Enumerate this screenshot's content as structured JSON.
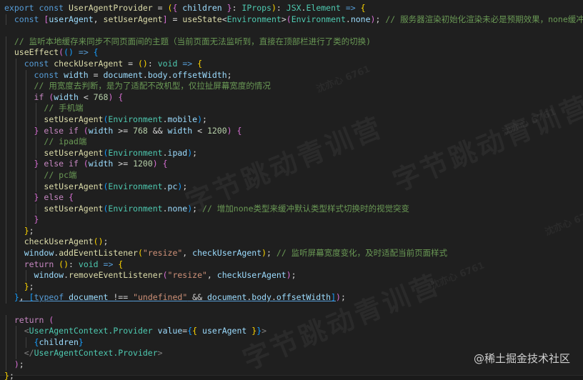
{
  "editor": {
    "theme": {
      "background": "#1f1f1f",
      "keyword": "#569cd6",
      "control": "#c586c0",
      "function": "#dcdcaa",
      "variable": "#9cdcfe",
      "type": "#4ec9b0",
      "string": "#ce9178",
      "number": "#b5cea8",
      "comment": "#6a9955"
    },
    "lines": [
      {
        "indent": 0,
        "tokens": [
          [
            "keyword",
            "export const "
          ],
          [
            "function",
            "UserAgentProvider"
          ],
          [
            "plain",
            " = "
          ],
          [
            "bracket1",
            "("
          ],
          [
            "bracket2",
            "{"
          ],
          [
            "variable",
            " children "
          ],
          [
            "bracket2",
            "}"
          ],
          [
            "plain",
            ": "
          ],
          [
            "type",
            "IProps"
          ],
          [
            "bracket1",
            ")"
          ],
          [
            "plain",
            ": "
          ],
          [
            "type",
            "JSX"
          ],
          [
            "plain",
            "."
          ],
          [
            "type",
            "Element"
          ],
          [
            "keyword",
            " => "
          ],
          [
            "bracket1",
            "{"
          ]
        ]
      },
      {
        "indent": 1,
        "tokens": [
          [
            "keyword",
            "const "
          ],
          [
            "bracket2",
            "["
          ],
          [
            "variable",
            "userAgent"
          ],
          [
            "plain",
            ", "
          ],
          [
            "function",
            "setUserAgent"
          ],
          [
            "bracket2",
            "]"
          ],
          [
            "plain",
            " = "
          ],
          [
            "function",
            "useState"
          ],
          [
            "plain",
            "<"
          ],
          [
            "type",
            "Environment"
          ],
          [
            "plain",
            ">"
          ],
          [
            "bracket2",
            "("
          ],
          [
            "type",
            "Environment"
          ],
          [
            "plain",
            "."
          ],
          [
            "variable",
            "none"
          ],
          [
            "bracket2",
            ")"
          ],
          [
            "plain",
            "; "
          ],
          [
            "comment",
            "// 服务器渲染初始化渲染未必是预期效果，none缓冲切换视觉"
          ]
        ]
      },
      {
        "indent": 0,
        "tokens": []
      },
      {
        "indent": 1,
        "tokens": [
          [
            "comment",
            "// 监听本地缓存来同步不同页面间的主题（当前页面无法监听到，直接在顶部栏进行了类的切换)"
          ]
        ]
      },
      {
        "indent": 1,
        "tokens": [
          [
            "function",
            "useEffect"
          ],
          [
            "bracket2",
            "("
          ],
          [
            "bracket3",
            "()"
          ],
          [
            "keyword",
            " => "
          ],
          [
            "bracket3",
            "{"
          ]
        ]
      },
      {
        "indent": 2,
        "tokens": [
          [
            "keyword",
            "const "
          ],
          [
            "function",
            "checkUserAgent"
          ],
          [
            "plain",
            " = "
          ],
          [
            "bracket1",
            "()"
          ],
          [
            "plain",
            ": "
          ],
          [
            "type",
            "void"
          ],
          [
            "keyword",
            " => "
          ],
          [
            "bracket1",
            "{"
          ]
        ]
      },
      {
        "indent": 3,
        "tokens": [
          [
            "keyword",
            "const "
          ],
          [
            "variable",
            "width"
          ],
          [
            "plain",
            " = "
          ],
          [
            "variable",
            "document"
          ],
          [
            "plain",
            "."
          ],
          [
            "variable",
            "body"
          ],
          [
            "plain",
            "."
          ],
          [
            "variable",
            "offsetWidth"
          ],
          [
            "plain",
            ";"
          ]
        ]
      },
      {
        "indent": 3,
        "tokens": [
          [
            "comment",
            "// 用宽度去判断，是为了适配不改机型，仅拉扯屏幕宽度的情况"
          ]
        ]
      },
      {
        "indent": 3,
        "tokens": [
          [
            "control",
            "if "
          ],
          [
            "bracket2",
            "("
          ],
          [
            "variable",
            "width"
          ],
          [
            "plain",
            " < "
          ],
          [
            "number",
            "768"
          ],
          [
            "bracket2",
            ")"
          ],
          [
            "plain",
            " "
          ],
          [
            "bracket2",
            "{"
          ]
        ]
      },
      {
        "indent": 4,
        "tokens": [
          [
            "comment",
            "// 手机端"
          ]
        ]
      },
      {
        "indent": 4,
        "tokens": [
          [
            "function",
            "setUserAgent"
          ],
          [
            "bracket3",
            "("
          ],
          [
            "type",
            "Environment"
          ],
          [
            "plain",
            "."
          ],
          [
            "variable",
            "mobile"
          ],
          [
            "bracket3",
            ")"
          ],
          [
            "plain",
            ";"
          ]
        ]
      },
      {
        "indent": 3,
        "tokens": [
          [
            "bracket2",
            "}"
          ],
          [
            "control",
            " else if "
          ],
          [
            "bracket2",
            "("
          ],
          [
            "variable",
            "width"
          ],
          [
            "plain",
            " >= "
          ],
          [
            "number",
            "768"
          ],
          [
            "plain",
            " && "
          ],
          [
            "variable",
            "width"
          ],
          [
            "plain",
            " < "
          ],
          [
            "number",
            "1200"
          ],
          [
            "bracket2",
            ")"
          ],
          [
            "plain",
            " "
          ],
          [
            "bracket2",
            "{"
          ]
        ]
      },
      {
        "indent": 4,
        "tokens": [
          [
            "comment",
            "// ipad端"
          ]
        ]
      },
      {
        "indent": 4,
        "tokens": [
          [
            "function",
            "setUserAgent"
          ],
          [
            "bracket3",
            "("
          ],
          [
            "type",
            "Environment"
          ],
          [
            "plain",
            "."
          ],
          [
            "variable",
            "ipad"
          ],
          [
            "bracket3",
            ")"
          ],
          [
            "plain",
            ";"
          ]
        ]
      },
      {
        "indent": 3,
        "tokens": [
          [
            "bracket2",
            "}"
          ],
          [
            "control",
            " else if "
          ],
          [
            "bracket2",
            "("
          ],
          [
            "variable",
            "width"
          ],
          [
            "plain",
            " >= "
          ],
          [
            "number",
            "1200"
          ],
          [
            "bracket2",
            ")"
          ],
          [
            "plain",
            " "
          ],
          [
            "bracket2",
            "{"
          ]
        ]
      },
      {
        "indent": 4,
        "tokens": [
          [
            "comment",
            "// pc端"
          ]
        ]
      },
      {
        "indent": 4,
        "tokens": [
          [
            "function",
            "setUserAgent"
          ],
          [
            "bracket3",
            "("
          ],
          [
            "type",
            "Environment"
          ],
          [
            "plain",
            "."
          ],
          [
            "variable",
            "pc"
          ],
          [
            "bracket3",
            ")"
          ],
          [
            "plain",
            ";"
          ]
        ]
      },
      {
        "indent": 3,
        "tokens": [
          [
            "bracket2",
            "}"
          ],
          [
            "control",
            " else "
          ],
          [
            "bracket2",
            "{"
          ]
        ]
      },
      {
        "indent": 4,
        "tokens": [
          [
            "function",
            "setUserAgent"
          ],
          [
            "bracket3",
            "("
          ],
          [
            "type",
            "Environment"
          ],
          [
            "plain",
            "."
          ],
          [
            "variable",
            "none"
          ],
          [
            "bracket3",
            ")"
          ],
          [
            "plain",
            "; "
          ],
          [
            "comment",
            "// 增加none类型来缓冲默认类型样式切换时的视觉突变"
          ]
        ]
      },
      {
        "indent": 3,
        "tokens": [
          [
            "bracket2",
            "}"
          ]
        ]
      },
      {
        "indent": 2,
        "tokens": [
          [
            "bracket1",
            "}"
          ],
          [
            "plain",
            ";"
          ]
        ]
      },
      {
        "indent": 2,
        "tokens": [
          [
            "function",
            "checkUserAgent"
          ],
          [
            "bracket1",
            "()"
          ],
          [
            "plain",
            ";"
          ]
        ]
      },
      {
        "indent": 2,
        "tokens": [
          [
            "variable",
            "window"
          ],
          [
            "plain",
            "."
          ],
          [
            "function",
            "addEventListener"
          ],
          [
            "bracket1",
            "("
          ],
          [
            "string",
            "\"resize\""
          ],
          [
            "plain",
            ", "
          ],
          [
            "variable",
            "checkUserAgent"
          ],
          [
            "bracket1",
            ")"
          ],
          [
            "plain",
            "; "
          ],
          [
            "comment",
            "// 监听屏幕宽度变化，及时适配当前页面样式"
          ]
        ]
      },
      {
        "indent": 2,
        "tokens": [
          [
            "control",
            "return "
          ],
          [
            "bracket1",
            "()"
          ],
          [
            "plain",
            ": "
          ],
          [
            "type",
            "void"
          ],
          [
            "keyword",
            " => "
          ],
          [
            "bracket1",
            "{"
          ]
        ]
      },
      {
        "indent": 3,
        "tokens": [
          [
            "variable",
            "window"
          ],
          [
            "plain",
            "."
          ],
          [
            "function",
            "removeEventListener"
          ],
          [
            "bracket2",
            "("
          ],
          [
            "string",
            "\"resize\""
          ],
          [
            "plain",
            ", "
          ],
          [
            "variable",
            "checkUserAgent"
          ],
          [
            "bracket2",
            ")"
          ],
          [
            "plain",
            ";"
          ]
        ]
      },
      {
        "indent": 2,
        "tokens": [
          [
            "bracket1",
            "}"
          ],
          [
            "plain",
            ";"
          ]
        ]
      },
      {
        "indent": 1,
        "tokens": [
          [
            "bracket3",
            "}"
          ],
          [
            "plain",
            ", "
          ],
          [
            "bracket3",
            "["
          ],
          [
            "keyword",
            "typeof "
          ],
          [
            "variable",
            "document"
          ],
          [
            "plain",
            " !== "
          ],
          [
            "string",
            "\"undefined\""
          ],
          [
            "plain",
            " && "
          ],
          [
            "variable",
            "document"
          ],
          [
            "plain",
            "."
          ],
          [
            "variable",
            "body"
          ],
          [
            "plain",
            "."
          ],
          [
            "variable",
            "offsetWidth"
          ],
          [
            "bracket3",
            "]"
          ],
          [
            "bracket2",
            ")"
          ],
          [
            "plain",
            ";"
          ]
        ]
      },
      {
        "indent": 0,
        "tokens": []
      },
      {
        "indent": 1,
        "tokens": [
          [
            "control",
            "return "
          ],
          [
            "bracket2",
            "("
          ]
        ]
      },
      {
        "indent": 2,
        "tokens": [
          [
            "punct-tag",
            "<"
          ],
          [
            "tag",
            "UserAgentContext.Provider"
          ],
          [
            "variable",
            " value"
          ],
          [
            "plain",
            "="
          ],
          [
            "bracket3",
            "{"
          ],
          [
            "bracket1",
            "{"
          ],
          [
            "variable",
            " userAgent "
          ],
          [
            "bracket1",
            "}"
          ],
          [
            "bracket3",
            "}"
          ],
          [
            "punct-tag",
            ">"
          ]
        ]
      },
      {
        "indent": 3,
        "tokens": [
          [
            "bracket3",
            "{"
          ],
          [
            "variable",
            "children"
          ],
          [
            "bracket3",
            "}"
          ]
        ]
      },
      {
        "indent": 2,
        "tokens": [
          [
            "punct-tag",
            "</"
          ],
          [
            "tag",
            "UserAgentContext.Provider"
          ],
          [
            "punct-tag",
            ">"
          ]
        ]
      },
      {
        "indent": 1,
        "tokens": [
          [
            "bracket2",
            ")"
          ],
          [
            "plain",
            ";"
          ]
        ]
      },
      {
        "indent": 0,
        "tokens": [
          [
            "bracket1",
            "}"
          ],
          [
            "plain",
            ";"
          ]
        ]
      }
    ]
  },
  "watermark": {
    "big": "字节跳动青训营",
    "small": "沈亦心 6761"
  },
  "credit": "@稀土掘金技术社区"
}
